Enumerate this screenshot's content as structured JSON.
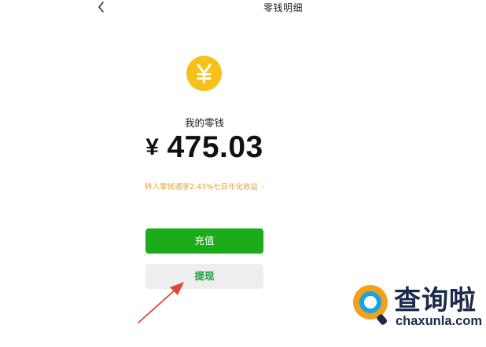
{
  "header": {
    "title": "零钱明细",
    "back_icon": "chevron-left-icon"
  },
  "wallet": {
    "coin_icon": "yuan-coin-icon",
    "coin_color": "#f7c01a",
    "label": "我的零钱",
    "currency_symbol": "¥",
    "amount": "475.03",
    "yield_text": "转入零钱通享2.43%七日年化收益",
    "yield_color": "#e3a22e"
  },
  "actions": {
    "topup_label": "充值",
    "topup_color": "#1aad19",
    "withdraw_label": "提现"
  },
  "annotation": {
    "arrow_color": "#e0453a"
  },
  "watermark": {
    "title": "查询啦",
    "url": "chaxunla.com"
  }
}
